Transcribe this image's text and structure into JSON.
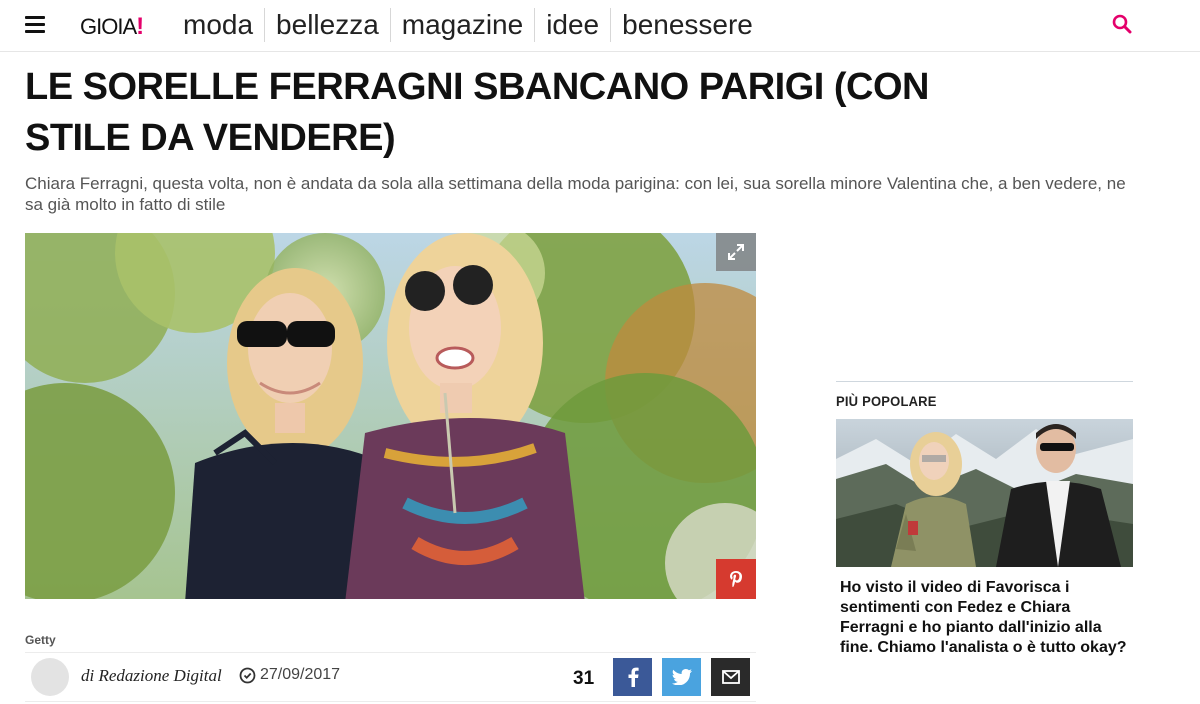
{
  "header": {
    "logo_text": "GIOIA",
    "logo_mark": "!",
    "nav": [
      "moda",
      "bellezza",
      "magazine",
      "idee",
      "benessere"
    ],
    "icons": {
      "menu": "hamburger-icon",
      "search": "search-icon"
    },
    "accent_color": "#e4006b"
  },
  "article": {
    "title": "LE SORELLE FERRAGNI SBANCANO PARIGI (CON STILE DA VENDERE)",
    "subtitle": "Chiara Ferragni, questa volta, non è andata da sola alla settimana della moda parigina: con lei, sua sorella minore Valentina che, a ben vedere, ne sa già molto in fatto di stile",
    "image_credit": "Getty",
    "author": "di Redazione Digital",
    "date": "27/09/2017",
    "share_count": "31",
    "share_icons": [
      "facebook-icon",
      "twitter-icon",
      "mail-icon"
    ],
    "share_colors": {
      "facebook": "#3b5998",
      "twitter": "#4aa3df",
      "mail": "#2a2a2a",
      "pinterest": "#d63a2f"
    }
  },
  "sidebar": {
    "popular_title": "PIÙ POPOLARE",
    "headline": "Ho visto il video di Favorisca i sentimenti con Fedez e Chiara Ferragni e ho pianto dall'inizio alla fine. Chiamo l'analista o è tutto okay?"
  }
}
